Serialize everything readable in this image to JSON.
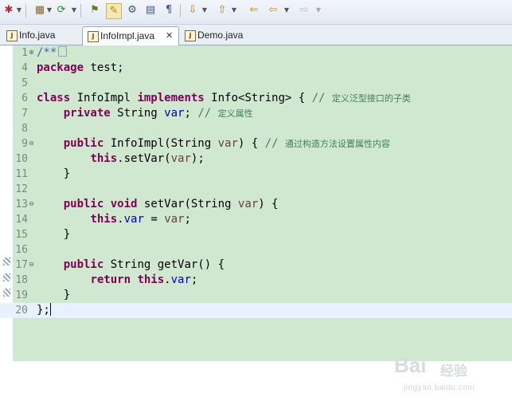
{
  "toolbar": {
    "buttons": [
      {
        "name": "debug-icon",
        "glyph": "✱"
      },
      {
        "name": "run-icon",
        "glyph": "▶"
      },
      {
        "name": "new-package-icon",
        "glyph": "▦"
      },
      {
        "name": "refresh-icon",
        "glyph": "⟳"
      },
      {
        "name": "open-type-icon",
        "glyph": "⚑"
      },
      {
        "name": "highlight-icon",
        "glyph": "✎"
      },
      {
        "name": "mark-occurrences-icon",
        "glyph": "⚙"
      },
      {
        "name": "toggle-block-icon",
        "glyph": "▤"
      },
      {
        "name": "show-whitespace-icon",
        "glyph": "¶"
      },
      {
        "name": "next-annotation-icon",
        "glyph": "⇩"
      },
      {
        "name": "previous-annotation-icon",
        "glyph": "⇧"
      },
      {
        "name": "last-edit-icon",
        "glyph": "⇐"
      },
      {
        "name": "back-icon",
        "glyph": "⇦"
      },
      {
        "name": "forward-icon",
        "glyph": "⇨"
      }
    ]
  },
  "tabs": [
    {
      "label": "Info.java",
      "active": false
    },
    {
      "label": "InfoImpl.java",
      "active": true,
      "close": "✕"
    },
    {
      "label": "Demo.java",
      "active": false
    }
  ],
  "editor": {
    "lines": [
      {
        "num": "1",
        "fold": "⊕"
      },
      {
        "num": "4"
      },
      {
        "num": "5"
      },
      {
        "num": "6"
      },
      {
        "num": "7"
      },
      {
        "num": "8"
      },
      {
        "num": "9",
        "fold": "⊖"
      },
      {
        "num": "10"
      },
      {
        "num": "11"
      },
      {
        "num": "12"
      },
      {
        "num": "13",
        "fold": "⊖"
      },
      {
        "num": "14"
      },
      {
        "num": "15"
      },
      {
        "num": "16"
      },
      {
        "num": "17",
        "fold": "⊖"
      },
      {
        "num": "18"
      },
      {
        "num": "19"
      },
      {
        "num": "20"
      }
    ],
    "tokens": {
      "l1": "/**",
      "l4_kw": "package",
      "l4_rest": " test;",
      "l6_kw1": "class",
      "l6_mid": " InfoImpl ",
      "l6_kw2": "implements",
      "l6_rest": " Info<String> { ",
      "l6_cm": "// ",
      "l6_cmz": "定义泛型接口的子类",
      "l7_indent": "    ",
      "l7_kw": "private",
      "l7_mid": " String ",
      "l7_fld": "var",
      "l7_rest": "; ",
      "l7_cm": "// ",
      "l7_cmz": "定义属性",
      "l9_indent": "    ",
      "l9_kw": "public",
      "l9_mid": " InfoImpl(String ",
      "l9_var": "var",
      "l9_rest": ") { ",
      "l9_cm": "// ",
      "l9_cmz": "通过构造方法设置属性内容",
      "l10_indent": "        ",
      "l10_kw": "this",
      "l10_mid": ".setVar(",
      "l10_var": "var",
      "l10_rest": ");",
      "l11": "    }",
      "l13_indent": "    ",
      "l13_kw1": "public",
      "l13_sp": " ",
      "l13_kw2": "void",
      "l13_mid": " setVar(String ",
      "l13_var": "var",
      "l13_rest": ") {",
      "l14_indent": "        ",
      "l14_kw": "this",
      "l14_dot": ".",
      "l14_fld": "var",
      "l14_eq": " = ",
      "l14_var": "var",
      "l14_end": ";",
      "l15": "    }",
      "l17_indent": "    ",
      "l17_kw": "public",
      "l17_rest": " String getVar() {",
      "l18_indent": "        ",
      "l18_kw1": "return",
      "l18_sp": " ",
      "l18_kw2": "this",
      "l18_dot": ".",
      "l18_fld": "var",
      "l18_end": ";",
      "l19": "    }",
      "l20": "};"
    }
  },
  "watermark": {
    "logo": "Bai",
    "logo2": "经验",
    "url": "jingyan.baidu.com"
  }
}
